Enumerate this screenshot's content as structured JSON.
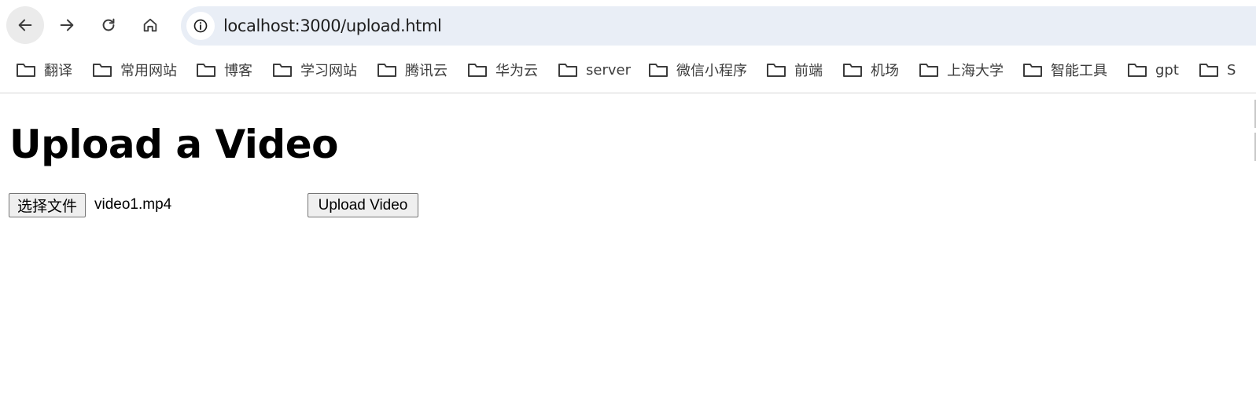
{
  "browser": {
    "nav": {
      "back_icon": "arrow-left-icon",
      "forward_icon": "arrow-right-icon",
      "reload_icon": "reload-icon",
      "home_icon": "home-icon"
    },
    "omnibox": {
      "site_info_icon": "info-circle-icon",
      "url": "localhost:3000/upload.html",
      "background": "#e9eef6"
    },
    "bookmarks": [
      {
        "label": "翻译",
        "icon": "folder-icon"
      },
      {
        "label": "常用网站",
        "icon": "folder-icon"
      },
      {
        "label": "博客",
        "icon": "folder-icon"
      },
      {
        "label": "学习网站",
        "icon": "folder-icon"
      },
      {
        "label": "腾讯云",
        "icon": "folder-icon"
      },
      {
        "label": "华为云",
        "icon": "folder-icon"
      },
      {
        "label": "server",
        "icon": "folder-icon"
      },
      {
        "label": "微信小程序",
        "icon": "folder-icon"
      },
      {
        "label": "前端",
        "icon": "folder-icon"
      },
      {
        "label": "机场",
        "icon": "folder-icon"
      },
      {
        "label": "上海大学",
        "icon": "folder-icon"
      },
      {
        "label": "智能工具",
        "icon": "folder-icon"
      },
      {
        "label": "gpt",
        "icon": "folder-icon"
      },
      {
        "label": "S",
        "icon": "folder-icon"
      }
    ]
  },
  "page": {
    "title": "Upload a Video",
    "file_input": {
      "button_label": "选择文件",
      "selected_file": "video1.mp4"
    },
    "upload_button_label": "Upload Video"
  }
}
